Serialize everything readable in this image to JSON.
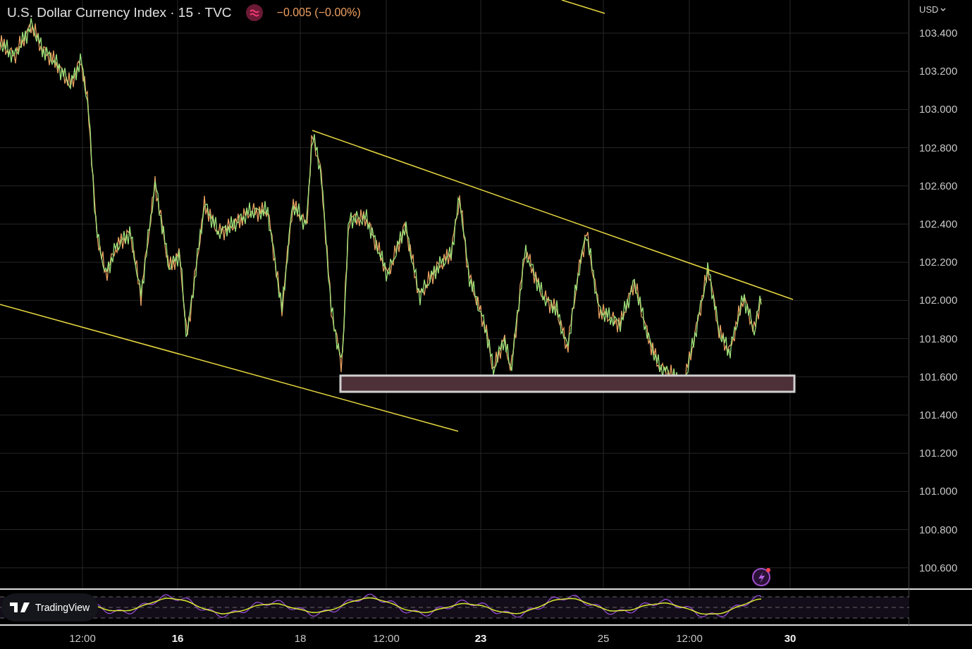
{
  "header": {
    "title": "U.S. Dollar Currency Index · 15 · TVC",
    "change": "−0.005 (−0.00%)"
  },
  "price_axis": {
    "currency": "USD",
    "labels": [
      "103.400",
      "103.200",
      "103.000",
      "102.800",
      "102.600",
      "102.400",
      "102.200",
      "102.000",
      "101.800",
      "101.600",
      "101.400",
      "101.200",
      "101.000",
      "100.800",
      "100.600"
    ]
  },
  "time_axis": {
    "labels": [
      {
        "label": "12:00",
        "bold": false
      },
      {
        "label": "16",
        "bold": true
      },
      {
        "label": "18",
        "bold": false
      },
      {
        "label": "12:00",
        "bold": false
      },
      {
        "label": "23",
        "bold": true
      },
      {
        "label": "25",
        "bold": false
      },
      {
        "label": "12:00",
        "bold": false
      },
      {
        "label": "30",
        "bold": true
      }
    ]
  },
  "logo": {
    "text": "TradingView"
  }
}
